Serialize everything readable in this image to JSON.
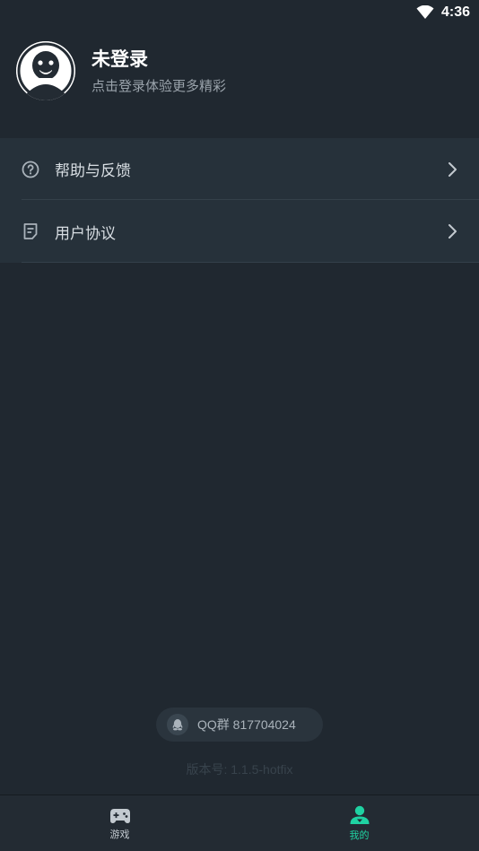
{
  "status_bar": {
    "time": "4:36",
    "icons": [
      "wifi-icon"
    ]
  },
  "profile": {
    "name": "未登录",
    "subtitle": "点击登录体验更多精彩",
    "avatar_icon": "default-avatar-icon"
  },
  "menu": {
    "items": [
      {
        "label": "帮助与反馈",
        "icon": "help-circle-icon"
      },
      {
        "label": "用户协议",
        "icon": "document-icon"
      }
    ]
  },
  "footer": {
    "qq_group": "QQ群 817704024",
    "version": "版本号: 1.1.5-hotfix"
  },
  "bottom_nav": {
    "tabs": [
      {
        "label": "游戏",
        "icon": "gamepad-icon",
        "active": false
      },
      {
        "label": "我的",
        "icon": "user-icon",
        "active": true
      }
    ]
  },
  "colors": {
    "background": "#202830",
    "menu_background": "#26313a",
    "accent": "#1fd2a2"
  }
}
